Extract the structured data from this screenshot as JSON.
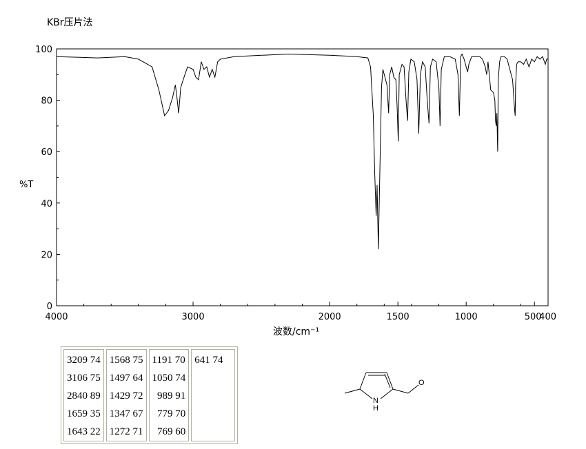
{
  "header": {
    "method": "KBr压片法"
  },
  "chart_data": {
    "type": "line",
    "ylabel": "%T",
    "xlabel": "波数/cm⁻¹",
    "xlim": [
      4000,
      400
    ],
    "ylim": [
      0,
      100
    ],
    "x_ticks": [
      {
        "value": 4000,
        "label": "4000"
      },
      {
        "value": 3000,
        "label": "3000"
      },
      {
        "value": 2000,
        "label": "2000"
      },
      {
        "value": 1500,
        "label": "1500"
      },
      {
        "value": 1000,
        "label": "1000"
      },
      {
        "value": 500,
        "label": "500"
      },
      {
        "value": 400,
        "label": "400"
      }
    ],
    "y_ticks": [
      0,
      20,
      40,
      60,
      80,
      100
    ],
    "series": [
      {
        "x": [
          4000,
          3700,
          3500,
          3400,
          3300,
          3250,
          3209,
          3180,
          3150,
          3130,
          3120,
          3106,
          3090,
          3060,
          3040,
          3000,
          2980,
          2960,
          2940,
          2920,
          2900,
          2880,
          2860,
          2840,
          2820,
          2800,
          2700,
          2500,
          2300,
          2000,
          1800,
          1720,
          1700,
          1680,
          1670,
          1659,
          1652,
          1643,
          1630,
          1620,
          1610,
          1590,
          1580,
          1568,
          1560,
          1545,
          1530,
          1515,
          1505,
          1497,
          1490,
          1470,
          1455,
          1440,
          1429,
          1420,
          1405,
          1380,
          1360,
          1347,
          1335,
          1320,
          1300,
          1285,
          1272,
          1262,
          1245,
          1220,
          1200,
          1191,
          1182,
          1160,
          1120,
          1080,
          1060,
          1050,
          1045,
          1040,
          1030,
          1015,
          1000,
          989,
          980,
          960,
          900,
          880,
          860,
          850,
          840,
          820,
          800,
          790,
          785,
          779,
          775,
          769,
          765,
          755,
          745,
          720,
          700,
          680,
          660,
          650,
          645,
          641,
          638,
          630,
          620,
          600,
          580,
          560,
          540,
          520,
          500,
          480,
          460,
          440,
          420,
          410,
          400
        ],
        "y": [
          97,
          96.5,
          97,
          96,
          93,
          84,
          74,
          76,
          81,
          86,
          82,
          75,
          85,
          90,
          93,
          92,
          89,
          88,
          95,
          92,
          93,
          89,
          92,
          89,
          95,
          96,
          97,
          97.5,
          98,
          97.5,
          97,
          96.5,
          93,
          74,
          52,
          35,
          47,
          22,
          58,
          85,
          92,
          88,
          86,
          75,
          90,
          93,
          89,
          88,
          77,
          64,
          90,
          94,
          93,
          80,
          72,
          91,
          96,
          95,
          88,
          67,
          90,
          95,
          93,
          80,
          71,
          93,
          96,
          95,
          85,
          70,
          92,
          97,
          97,
          96,
          90,
          74,
          85,
          97,
          98,
          96,
          93,
          91,
          94,
          97,
          97,
          96,
          93,
          90,
          95,
          84,
          83,
          80,
          72,
          70,
          75,
          60,
          88,
          95,
          97,
          97,
          96,
          92,
          88,
          80,
          76,
          74,
          86,
          94,
          95,
          95,
          94,
          96,
          93,
          96,
          95,
          97,
          96,
          97,
          94,
          96,
          96
        ]
      }
    ]
  },
  "peak_table": {
    "columns": [
      [
        "3209 74",
        "3106 75",
        "2840 89",
        "1659 35",
        "1643 22"
      ],
      [
        "1568 75",
        "1497 64",
        "1429 72",
        "1347 67",
        "1272 71"
      ],
      [
        "1191 70",
        "1050 74",
        "  989 91",
        "  779 70",
        "  769 60"
      ],
      [
        "641 74"
      ]
    ]
  },
  "structure": {
    "atom_o": "O",
    "atom_n": "N",
    "atom_h": "H"
  }
}
